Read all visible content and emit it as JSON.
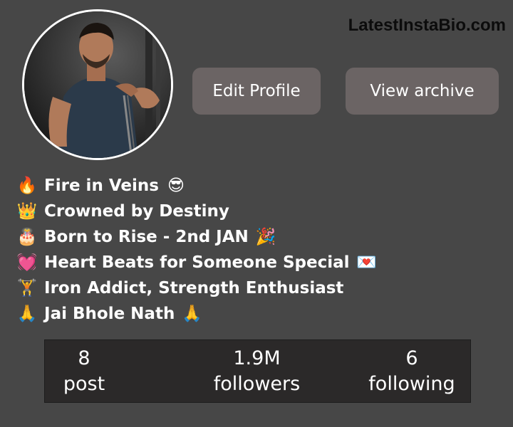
{
  "watermark": "LatestInstaBio.com",
  "profile": {
    "avatar_icon": "profile-photo-bodybuilder"
  },
  "buttons": {
    "edit_profile": "Edit Profile",
    "view_archive": "View archive"
  },
  "bio": [
    {
      "emoji": "🔥",
      "text": "Fire in Veins",
      "trail": "😎"
    },
    {
      "emoji": "👑",
      "text": "Crowned by Destiny",
      "trail": ""
    },
    {
      "emoji": "🎂",
      "text": "Born to Rise - 2nd JAN",
      "trail": "🎉"
    },
    {
      "emoji": "💓",
      "text": "Heart Beats for Someone Special",
      "trail": "💌"
    },
    {
      "emoji": "🏋",
      "text": "Iron Addict, Strength Enthusiast",
      "trail": ""
    },
    {
      "emoji": "🙏",
      "text": "Jai Bhole Nath",
      "trail": "🙏"
    }
  ],
  "stats": {
    "posts": {
      "value": "8",
      "label": "post"
    },
    "followers": {
      "value": "1.9M",
      "label": "followers"
    },
    "following": {
      "value": "6",
      "label": "following"
    }
  }
}
